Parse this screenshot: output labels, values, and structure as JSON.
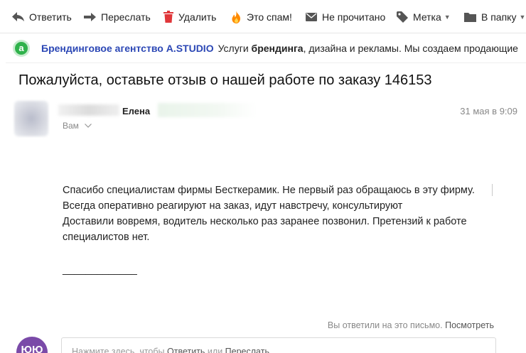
{
  "toolbar": {
    "reply": "Ответить",
    "forward": "Переслать",
    "delete": "Удалить",
    "spam": "Это спам!",
    "unread": "Не прочитано",
    "label": "Метка",
    "folder": "В папку"
  },
  "ad": {
    "logo_letter": "a",
    "title": "Брендинговое агентство A.STUDIO",
    "text_before": "Услуги ",
    "text_bold": "брендинга",
    "text_after": ", дизайна и рекламы. Мы создаем продающие"
  },
  "message": {
    "subject": "Пожалуйста, оставьте отзыв о нашей работе по заказу 146153",
    "sender_name": "Елена",
    "date": "31 мая в 9:09",
    "recipient": "Вам",
    "body": [
      "Спасибо специалистам фирмы Бесткерамик. Не первый раз обращаюсь в эту фирму.",
      "Всегда оперативно реагируют на заказ, идут навстречу, консультируют",
      "Доставили вовремя, водитель несколько раз заранее позвонил. Претензий к работе",
      "специалистов нет."
    ],
    "signature": "_____________"
  },
  "footer": {
    "replied_text": "Вы ответили на это письмо.",
    "view_link": "Посмотреть",
    "avatar_text": "ЮЮ",
    "reply_prompt_prefix": "Нажмите здесь, чтобы ",
    "reply_link": "Ответить",
    "reply_prompt_or": " или ",
    "forward_link": "Переслать"
  },
  "colors": {
    "link_blue": "#2b47b5",
    "delete_red": "#e0373a",
    "spam_orange": "#ff8a00",
    "ad_green": "#2fb24b",
    "avatar_purple": "#7a4aa8"
  }
}
